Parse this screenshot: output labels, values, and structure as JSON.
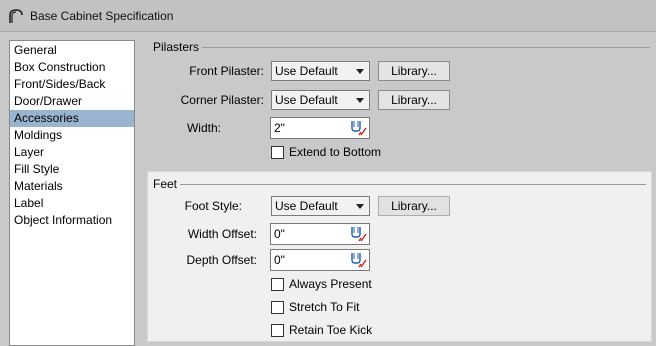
{
  "window": {
    "title": "Base Cabinet Specification"
  },
  "sidebar": {
    "items": [
      {
        "label": "General",
        "selected": false
      },
      {
        "label": "Box Construction",
        "selected": false
      },
      {
        "label": "Front/Sides/Back",
        "selected": false
      },
      {
        "label": "Door/Drawer",
        "selected": false
      },
      {
        "label": "Accessories",
        "selected": true
      },
      {
        "label": "Moldings",
        "selected": false
      },
      {
        "label": "Layer",
        "selected": false
      },
      {
        "label": "Fill Style",
        "selected": false
      },
      {
        "label": "Materials",
        "selected": false
      },
      {
        "label": "Label",
        "selected": false
      },
      {
        "label": "Object Information",
        "selected": false
      }
    ],
    "selected_color": "#99b4d1"
  },
  "pilasters": {
    "group_label": "Pilasters",
    "front_pilaster": {
      "label": "Front Pilaster:",
      "value": "Use Default",
      "library_label": "Library..."
    },
    "corner_pilaster": {
      "label": "Corner Pilaster:",
      "value": "Use Default",
      "library_label": "Library..."
    },
    "width": {
      "label": "Width:",
      "value": "2\""
    },
    "extend_to_bottom": {
      "label": "Extend to Bottom",
      "checked": false
    }
  },
  "feet": {
    "group_label": "Feet",
    "foot_style": {
      "label": "Foot Style:",
      "value": "Use Default",
      "library_label": "Library..."
    },
    "width_offset": {
      "label": "Width Offset:",
      "value": "0\""
    },
    "depth_offset": {
      "label": "Depth Offset:",
      "value": "0\""
    },
    "always_present": {
      "label": "Always Present",
      "checked": false
    },
    "stretch_to_fit": {
      "label": "Stretch To Fit",
      "checked": false
    },
    "retain_toe_kick": {
      "label": "Retain Toe Kick",
      "checked": false
    }
  },
  "icons": {
    "app": "cabinet-arch-icon",
    "unit": "dimension-unit-icon"
  }
}
